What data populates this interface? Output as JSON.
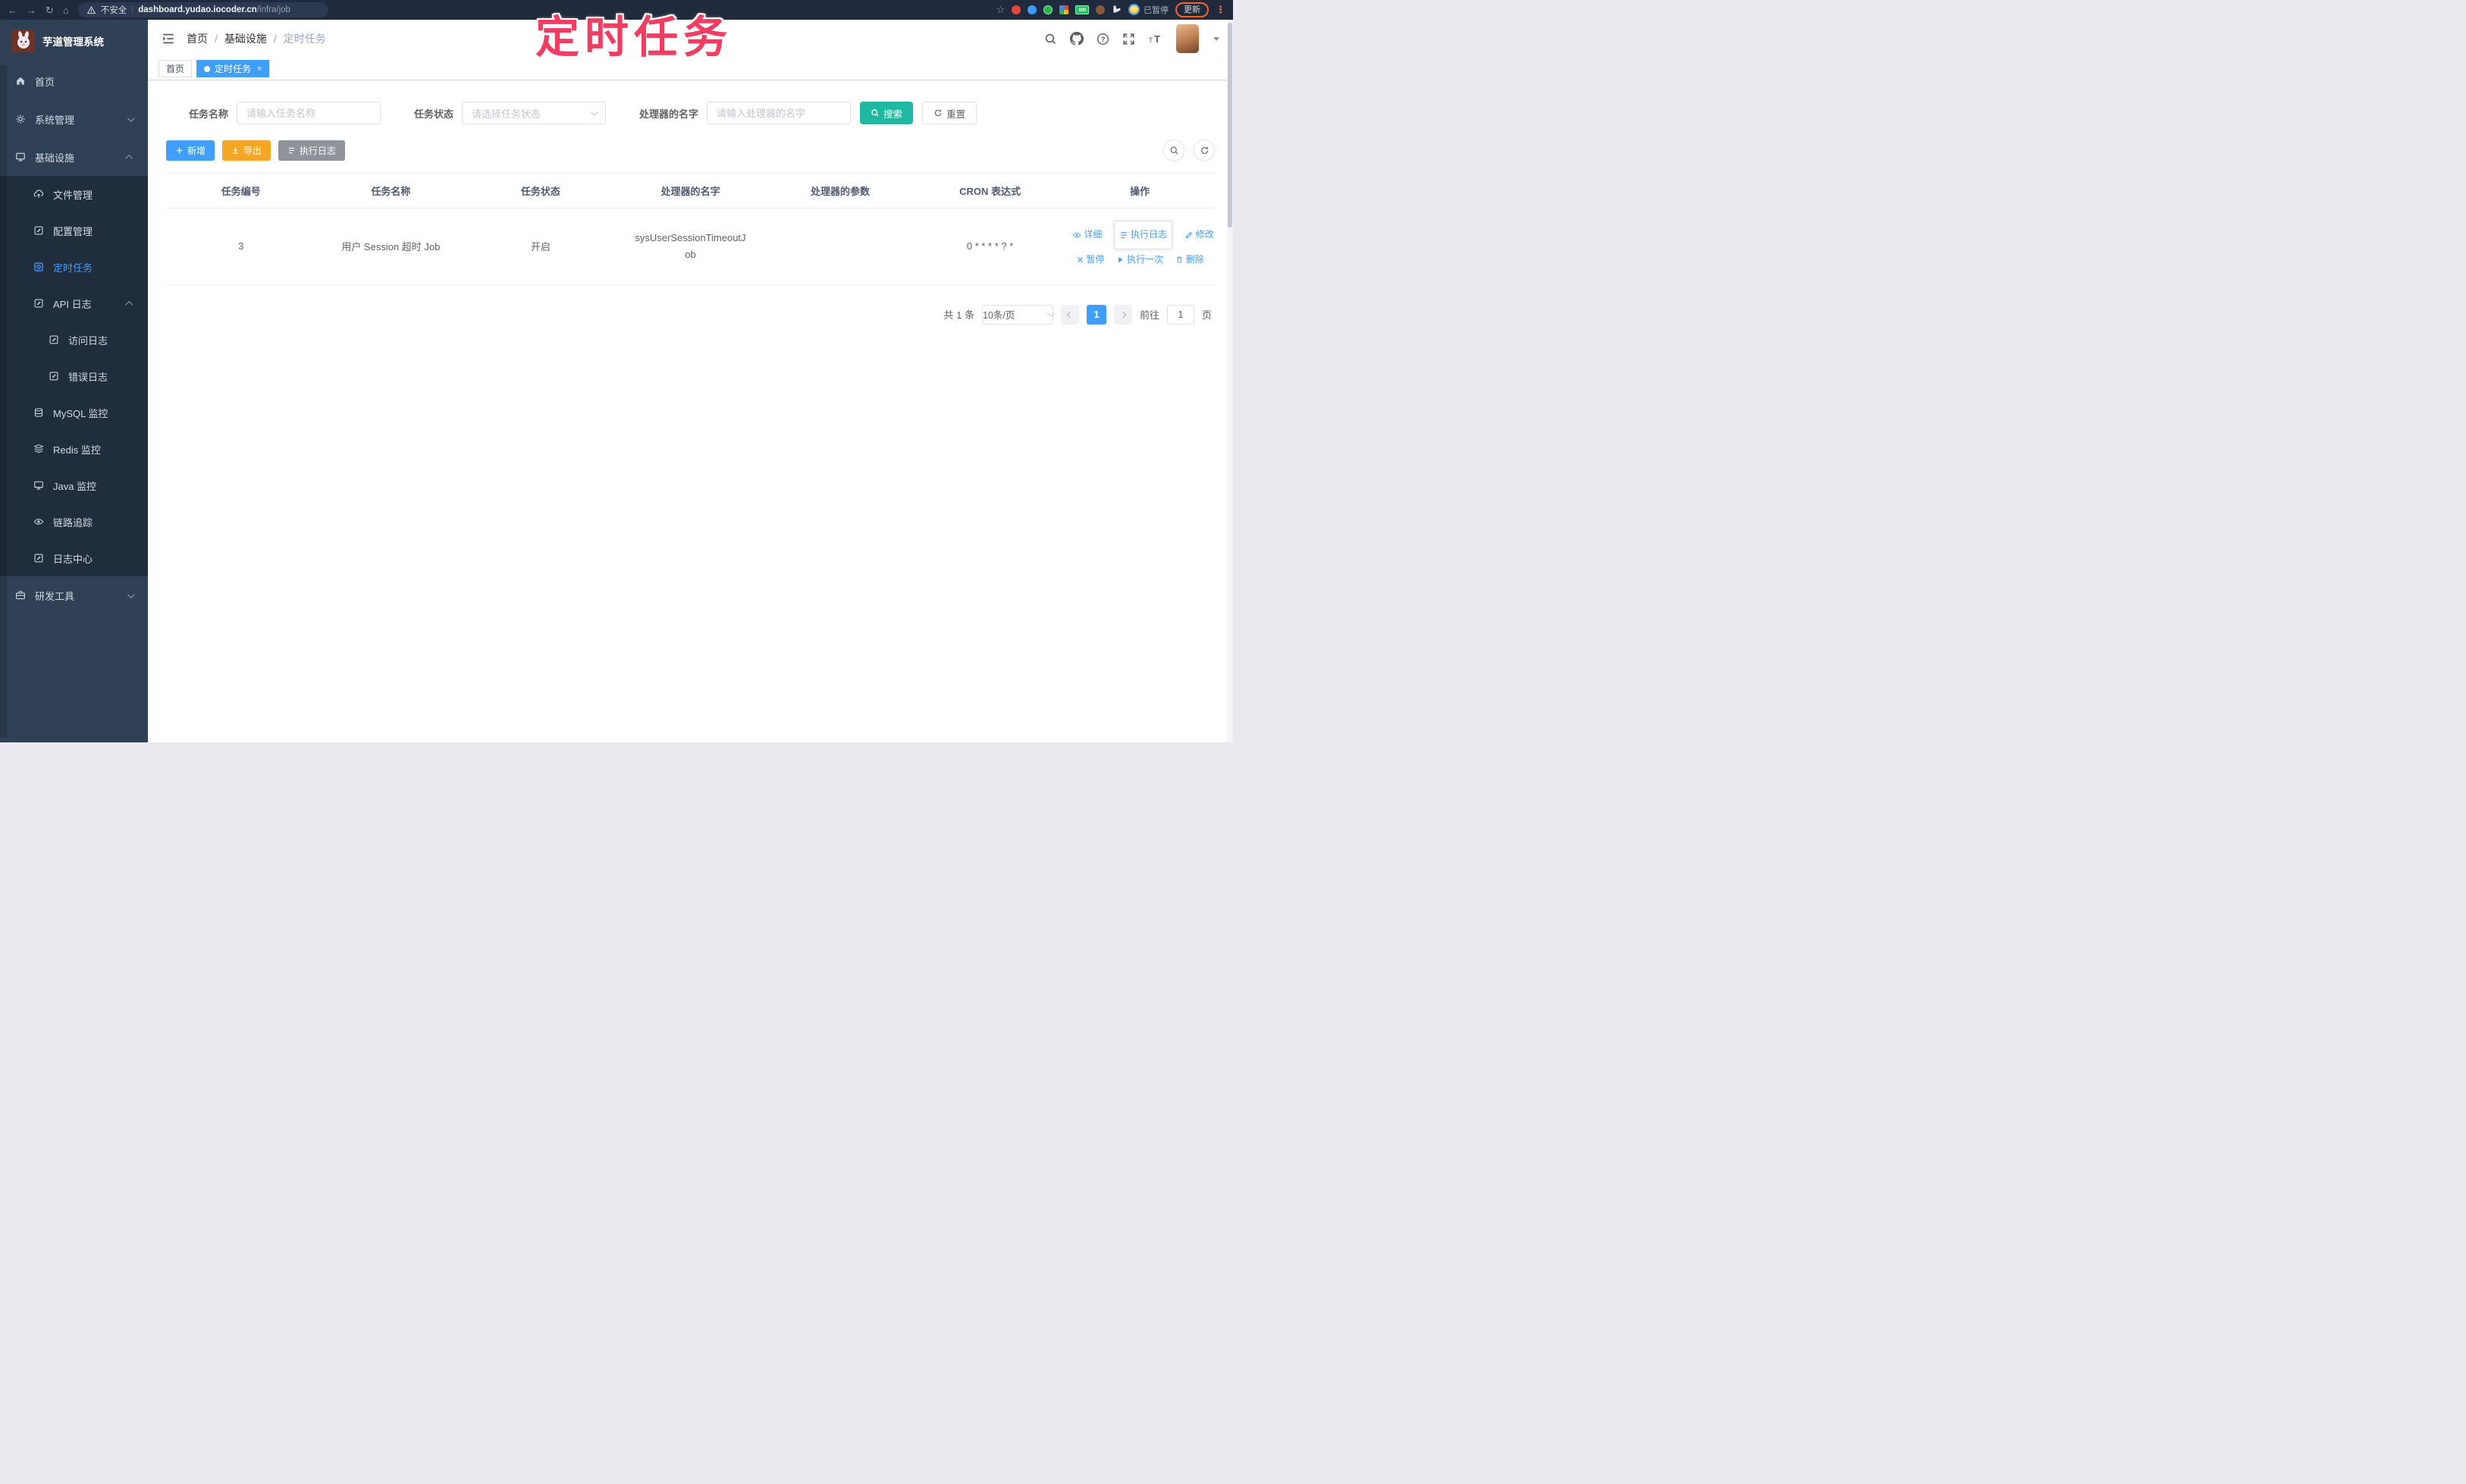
{
  "browser": {
    "security_label": "不安全",
    "url_host": "dashboard.yudao.iocoder.cn",
    "url_path": "/infra/job",
    "on_badge": "on",
    "paused_label": "已暂停",
    "update_label": "更新"
  },
  "annotation": {
    "text": "定时任务",
    "color": "#f43b62"
  },
  "sidebar": {
    "app_title": "芋道管理系统",
    "items": [
      {
        "label": "首页"
      },
      {
        "label": "系统管理"
      },
      {
        "label": "基础设施"
      },
      {
        "label": "文件管理"
      },
      {
        "label": "配置管理"
      },
      {
        "label": "定时任务"
      },
      {
        "label": "API 日志"
      },
      {
        "label": "访问日志"
      },
      {
        "label": "错误日志"
      },
      {
        "label": "MySQL 监控"
      },
      {
        "label": "Redis 监控"
      },
      {
        "label": "Java 监控"
      },
      {
        "label": "链路追踪"
      },
      {
        "label": "日志中心"
      },
      {
        "label": "研发工具"
      }
    ]
  },
  "header": {
    "breadcrumb": [
      "首页",
      "基础设施",
      "定时任务"
    ],
    "separator": "/",
    "tabs": [
      {
        "label": "首页"
      },
      {
        "label": "定时任务",
        "close": "×"
      }
    ]
  },
  "filters": {
    "name_label": "任务名称",
    "name_placeholder": "请输入任务名称",
    "status_label": "任务状态",
    "status_placeholder": "请选择任务状态",
    "handler_label": "处理器的名字",
    "handler_placeholder": "请输入处理器的名字",
    "search_label": "搜索",
    "reset_label": "重置"
  },
  "toolbar": {
    "add_label": "新增",
    "export_label": "导出",
    "job_log_label": "执行日志"
  },
  "table": {
    "headers": [
      "任务编号",
      "任务名称",
      "任务状态",
      "处理器的名字",
      "处理器的参数",
      "CRON 表达式",
      "操作"
    ],
    "row": {
      "id": "3",
      "name": "用户 Session 超时 Job",
      "status": "开启",
      "handler": "sysUserSessionTimeoutJob",
      "params": "",
      "cron": "0 * * * * ? *",
      "actions": {
        "detail": "详细",
        "log": "执行日志",
        "edit": "修改",
        "pause": "暂停",
        "run_once": "执行一次",
        "delete": "删除"
      }
    }
  },
  "pagination": {
    "total": "共 1 条",
    "page_size": "10条/页",
    "current_page": "1",
    "goto_label": "前往",
    "goto_value": "1",
    "page_unit": "页"
  },
  "colors": {
    "primary": "#409EFF",
    "search_teal": "#1eb9a0",
    "export_yellow": "#f5a623",
    "info_gray": "#909399",
    "sidebar_bg": "#304156",
    "submenu_bg": "#1f2d3d",
    "annotation_pink": "#f43b62",
    "browser_bar_bg": "#1f2a3c"
  }
}
